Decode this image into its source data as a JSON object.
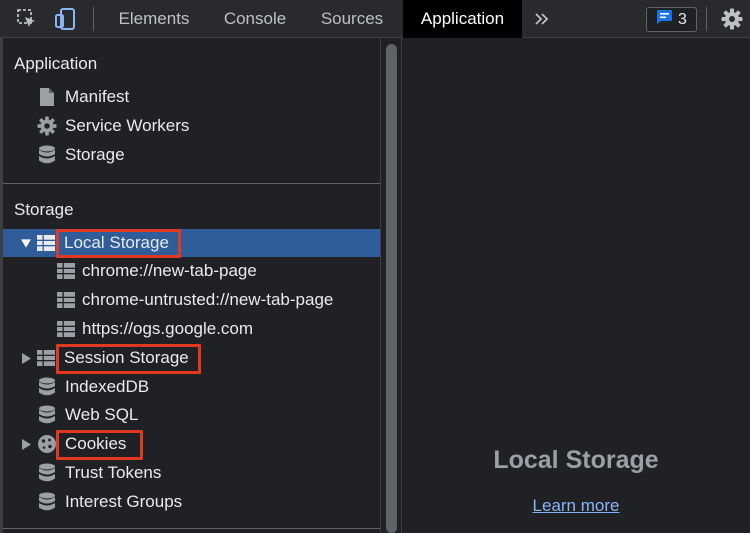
{
  "colors": {
    "toolbar_bg": "#292a2d",
    "panel_bg": "#202124",
    "active_tab_bg": "#000000",
    "selection_bg": "#2f5d99",
    "highlight_box": "#e2381f",
    "link": "#8ab4f8",
    "badge_icon": "#1a73e8"
  },
  "toolbar": {
    "inspect_icon": "inspect-element-icon",
    "device_icon": "device-toolbar-icon",
    "tabs": [
      {
        "label": "Elements"
      },
      {
        "label": "Console"
      },
      {
        "label": "Sources"
      },
      {
        "label": "Application",
        "active": true
      }
    ],
    "more_tabs_icon": "chevron-double-right-icon",
    "issues_badge": {
      "icon": "message-icon",
      "count": "3"
    },
    "settings_icon": "gear-icon"
  },
  "sidebar": {
    "application_section": {
      "title": "Application",
      "items": [
        {
          "label": "Manifest",
          "icon": "document-icon"
        },
        {
          "label": "Service Workers",
          "icon": "gear-icon"
        },
        {
          "label": "Storage",
          "icon": "database-icon"
        }
      ]
    },
    "storage_section": {
      "title": "Storage",
      "items": [
        {
          "label": "Local Storage",
          "icon": "table-grid-icon",
          "expanded": true,
          "selected": true,
          "highlighted": true
        },
        {
          "label": "chrome://new-tab-page",
          "icon": "table-grid-icon"
        },
        {
          "label": "chrome-untrusted://new-tab-page",
          "icon": "table-grid-icon"
        },
        {
          "label": "https://ogs.google.com",
          "icon": "table-grid-icon"
        },
        {
          "label": "Session Storage",
          "icon": "table-grid-icon",
          "expanded": false,
          "highlighted": true
        },
        {
          "label": "IndexedDB",
          "icon": "database-icon"
        },
        {
          "label": "Web SQL",
          "icon": "database-icon"
        },
        {
          "label": "Cookies",
          "icon": "cookie-icon",
          "expanded": false,
          "highlighted": true
        },
        {
          "label": "Trust Tokens",
          "icon": "database-icon"
        },
        {
          "label": "Interest Groups",
          "icon": "database-icon"
        }
      ]
    }
  },
  "main": {
    "title": "Local Storage",
    "learn_more": "Learn more"
  }
}
